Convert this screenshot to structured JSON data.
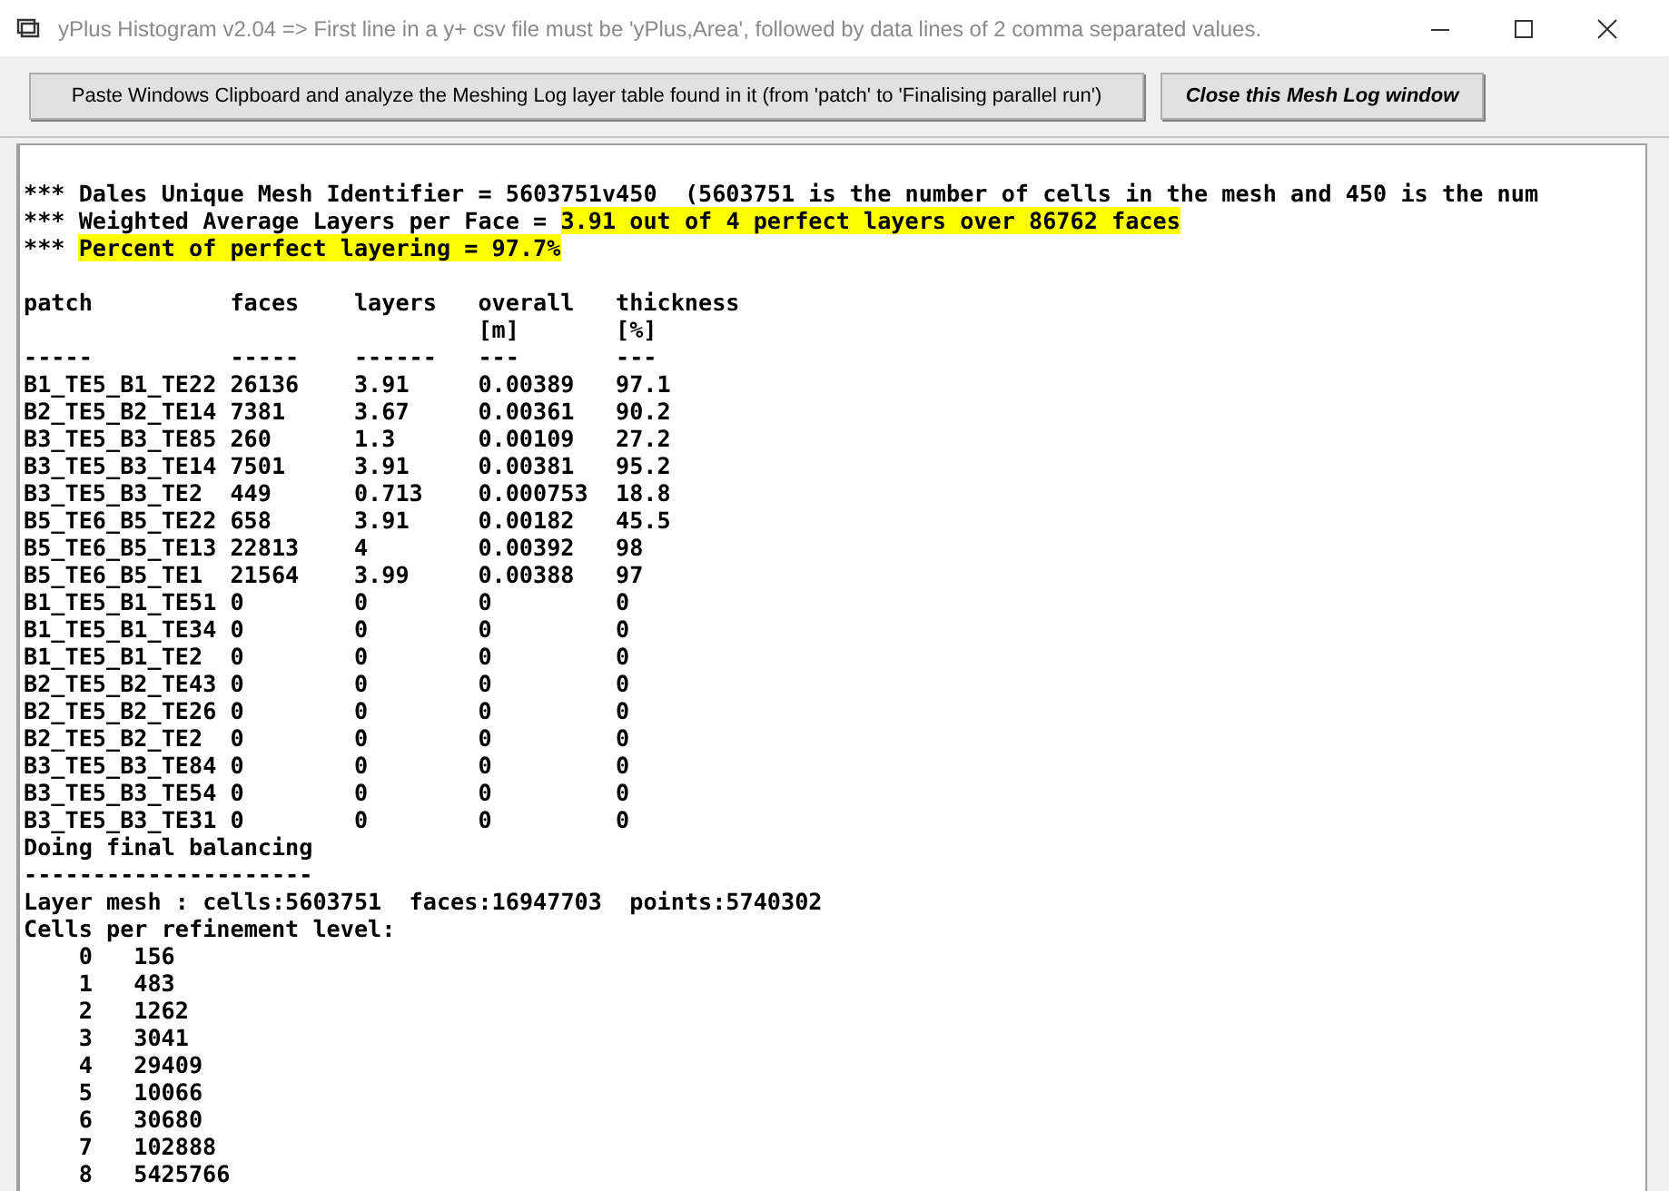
{
  "window": {
    "title": "yPlus Histogram v2.04 => First line in a y+ csv file must be 'yPlus,Area', followed by data lines of 2 comma separated values."
  },
  "buttons": [
    {
      "label": "Paste Windows Clipboard and analyze the Meshing Log layer table found in it (from 'patch' to 'Finalising parallel run')",
      "kind": "normal"
    },
    {
      "label": "Close this Mesh Log window",
      "kind": "emphasis"
    }
  ],
  "log": {
    "intro_lines": [
      {
        "parts": [
          {
            "text": "*** Dales Unique Mesh Identifier = 5603751v450  (5603751 is the number of cells in the mesh and 450 is the num",
            "highlighted": false
          }
        ]
      },
      {
        "parts": [
          {
            "text": "*** Weighted Average Layers per Face = ",
            "highlighted": false
          },
          {
            "text": "3.91 out of 4 perfect layers over 86762 faces",
            "highlighted": true
          }
        ]
      },
      {
        "parts": [
          {
            "text": "*** ",
            "highlighted": false
          },
          {
            "text": "Percent of perfect layering = 97.7%",
            "highlighted": true
          }
        ]
      }
    ],
    "table": {
      "columns": [
        {
          "label": "patch",
          "rule": "-----"
        },
        {
          "label": "faces",
          "rule": "-----"
        },
        {
          "label": "layers",
          "rule": "------"
        },
        {
          "label": "overall",
          "unit": "[m]",
          "rule": "---"
        },
        {
          "label": "thickness",
          "unit": "[%]",
          "rule": "---"
        }
      ],
      "rows": [
        [
          "B1_TE5_B1_TE22",
          "26136",
          "3.91",
          "0.00389",
          "97.1"
        ],
        [
          "B2_TE5_B2_TE14",
          "7381",
          "3.67",
          "0.00361",
          "90.2"
        ],
        [
          "B3_TE5_B3_TE85",
          "260",
          "1.3",
          "0.00109",
          "27.2"
        ],
        [
          "B3_TE5_B3_TE14",
          "7501",
          "3.91",
          "0.00381",
          "95.2"
        ],
        [
          "B3_TE5_B3_TE2",
          "449",
          "0.713",
          "0.000753",
          "18.8"
        ],
        [
          "B5_TE6_B5_TE22",
          "658",
          "3.91",
          "0.00182",
          "45.5"
        ],
        [
          "B5_TE6_B5_TE13",
          "22813",
          "4",
          "0.00392",
          "98"
        ],
        [
          "B5_TE6_B5_TE1",
          "21564",
          "3.99",
          "0.00388",
          "97"
        ],
        [
          "B1_TE5_B1_TE51",
          "0",
          "0",
          "0",
          "0"
        ],
        [
          "B1_TE5_B1_TE34",
          "0",
          "0",
          "0",
          "0"
        ],
        [
          "B1_TE5_B1_TE2",
          "0",
          "0",
          "0",
          "0"
        ],
        [
          "B2_TE5_B2_TE43",
          "0",
          "0",
          "0",
          "0"
        ],
        [
          "B2_TE5_B2_TE26",
          "0",
          "0",
          "0",
          "0"
        ],
        [
          "B2_TE5_B2_TE2",
          "0",
          "0",
          "0",
          "0"
        ],
        [
          "B3_TE5_B3_TE84",
          "0",
          "0",
          "0",
          "0"
        ],
        [
          "B3_TE5_B3_TE54",
          "0",
          "0",
          "0",
          "0"
        ],
        [
          "B3_TE5_B3_TE31",
          "0",
          "0",
          "0",
          "0"
        ]
      ]
    },
    "after_lines": [
      "Doing final balancing",
      "---------------------",
      "Layer mesh : cells:5603751  faces:16947703  points:5740302",
      "Cells per refinement level:"
    ],
    "refinement_levels": [
      {
        "level": "0",
        "cells": "156"
      },
      {
        "level": "1",
        "cells": "483"
      },
      {
        "level": "2",
        "cells": "1262"
      },
      {
        "level": "3",
        "cells": "3041"
      },
      {
        "level": "4",
        "cells": "29409"
      },
      {
        "level": "5",
        "cells": "10066"
      },
      {
        "level": "6",
        "cells": "30680"
      },
      {
        "level": "7",
        "cells": "102888"
      },
      {
        "level": "8",
        "cells": "5425766"
      }
    ]
  }
}
